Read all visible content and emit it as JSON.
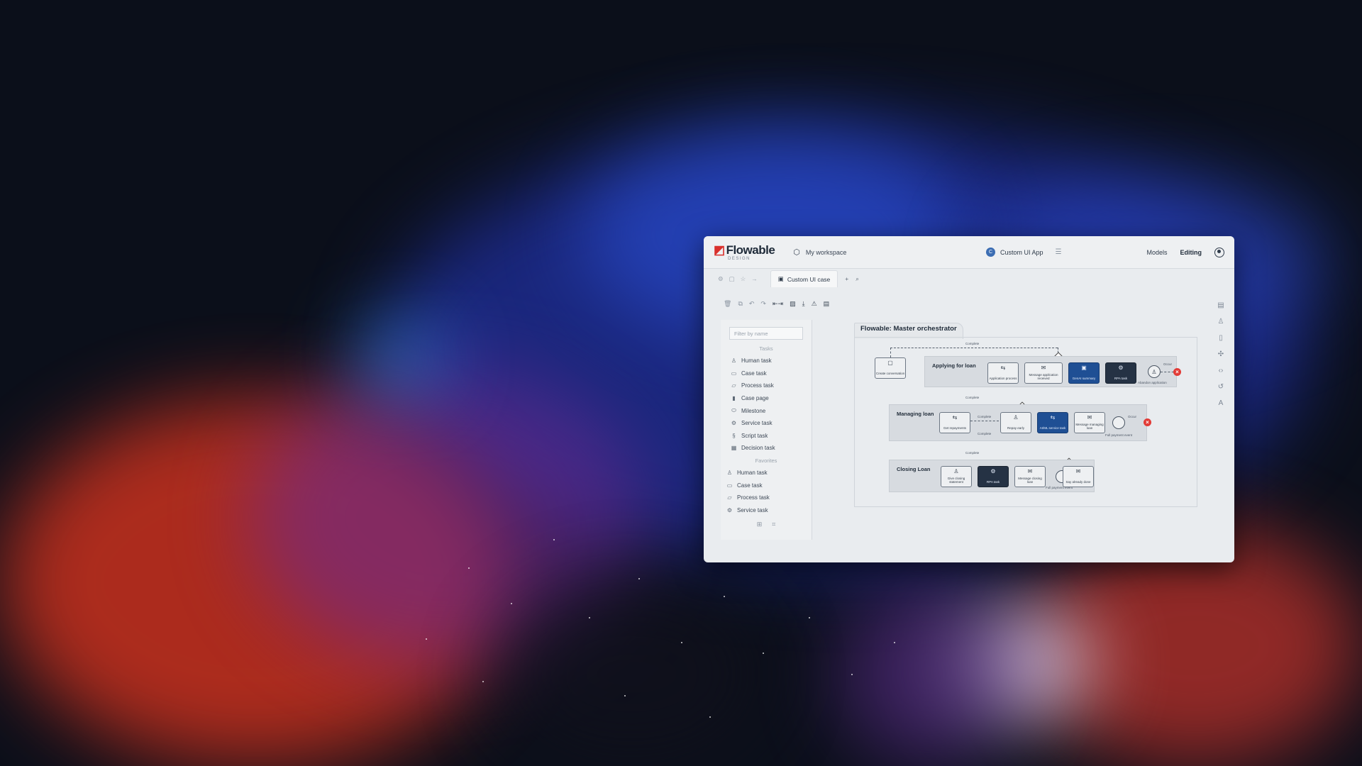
{
  "header": {
    "logo_text": "Flowable",
    "logo_sub": "DESIGN",
    "workspace_label": "My workspace",
    "app_badge": "C",
    "app_name": "Custom UI App",
    "nav_models": "Models",
    "nav_editing": "Editing"
  },
  "tabs": {
    "active_tab": "Custom UI case"
  },
  "palette": {
    "filter_placeholder": "Filter by name",
    "tasks_header": "Tasks",
    "tasks": [
      {
        "label": "Human task",
        "icon": "person-icon"
      },
      {
        "label": "Case task",
        "icon": "briefcase-icon"
      },
      {
        "label": "Process task",
        "icon": "process-icon"
      },
      {
        "label": "Case page",
        "icon": "page-icon"
      },
      {
        "label": "Milestone",
        "icon": "milestone-icon"
      },
      {
        "label": "Service task",
        "icon": "gear-icon"
      },
      {
        "label": "Script task",
        "icon": "script-icon"
      },
      {
        "label": "Decision task",
        "icon": "table-icon"
      }
    ],
    "favorites_header": "Favorites",
    "favorites": [
      {
        "label": "Human task",
        "icon": "person-icon"
      },
      {
        "label": "Case task",
        "icon": "briefcase-icon"
      },
      {
        "label": "Process task",
        "icon": "process-icon"
      },
      {
        "label": "Service task",
        "icon": "gear-icon"
      }
    ]
  },
  "diagram": {
    "title": "Flowable: Master orchestrator",
    "create_conversation": "Create conversation",
    "complete_label": "Complete",
    "stages": [
      {
        "label": "Applying for loan",
        "tasks": [
          "Application process",
          "Message application received",
          "GenAI summary",
          "RPA task"
        ],
        "event_label": "Occur",
        "event_sub": "Abandon application"
      },
      {
        "label": "Managing loan",
        "tasks": [
          "Get repayments",
          "Repay early",
          "AI/ML service task",
          "Message managing loan"
        ],
        "event_label": "Occur",
        "event_sub": "Full payment event"
      },
      {
        "label": "Closing Loan",
        "tasks": [
          "Give closing statement",
          "RPA task",
          "Message closing loan",
          "Say already done"
        ],
        "event_label": "Occur",
        "event_sub": "Full payment event"
      }
    ]
  },
  "colors": {
    "brand_red": "#d9302c",
    "task_blue": "#1f4f94",
    "task_dark": "#253244",
    "end_red": "#e23b36"
  }
}
